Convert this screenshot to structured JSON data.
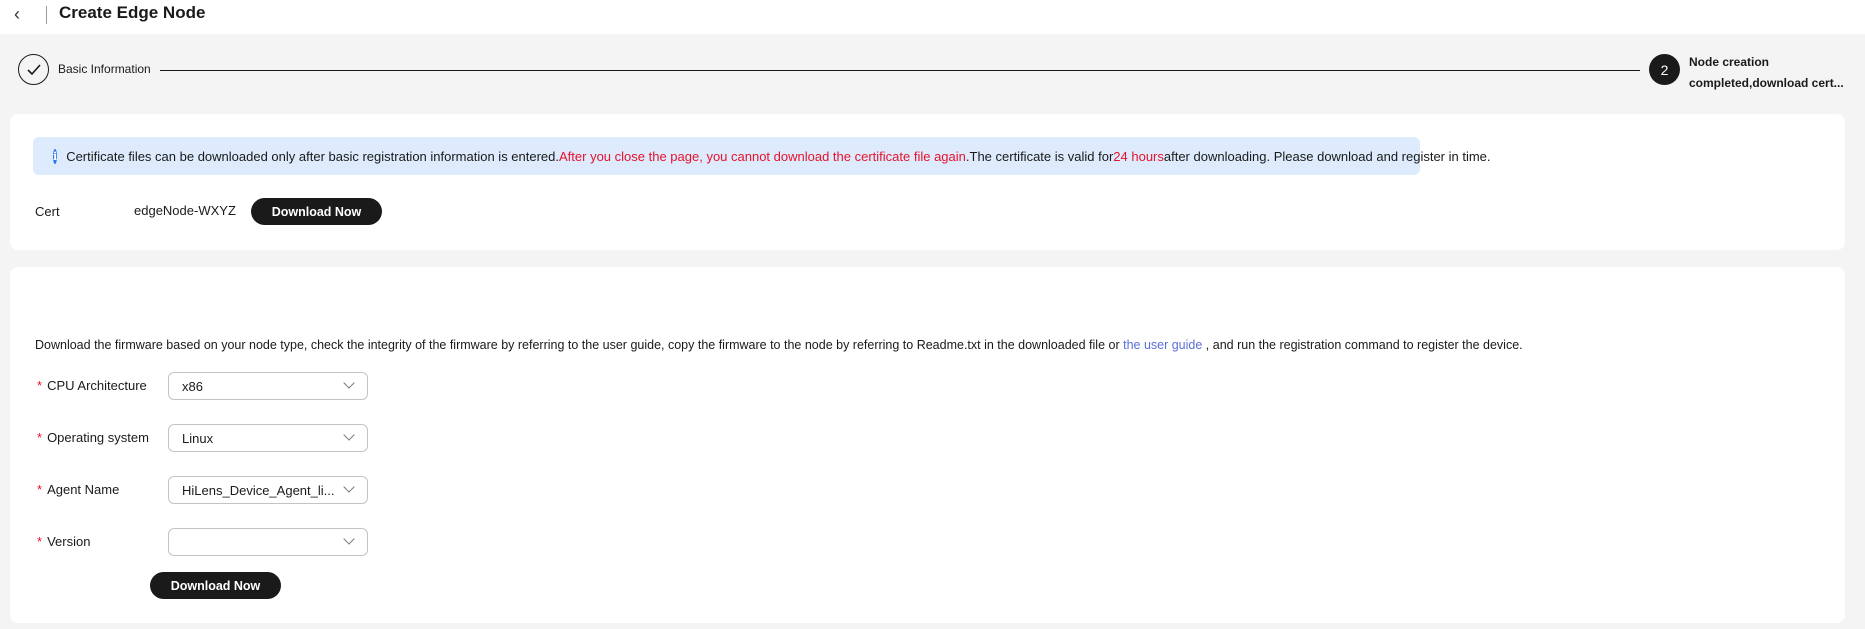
{
  "header": {
    "title": "Create Edge Node",
    "back_icon": "chevron-left-icon"
  },
  "steps": [
    {
      "number": "1",
      "label": "Basic Information",
      "status": "done"
    },
    {
      "number": "2",
      "label_line1": "Node creation",
      "label_line2": "completed,download cert..."
    }
  ],
  "notice": {
    "text1": "Certificate files can be downloaded only after basic registration information is entered. ",
    "warning": "After you close the page, you cannot download the certificate file again",
    "text2": " .The certificate is valid for ",
    "hours": "24 hours",
    "text3": " after downloading. Please download and register in time."
  },
  "cert": {
    "label": "Cert",
    "value": "edgeNode-WXYZ",
    "button": "Download Now"
  },
  "firmware": {
    "desc1": "Download the firmware based on your node type, check the integrity of the firmware by referring to the user guide, copy the firmware to the node by referring to Readme.txt in the downloaded file or ",
    "link": "the user guide",
    "desc2": " , and run the registration command to register the device.",
    "fields": [
      {
        "label": "CPU Architecture",
        "value": "x86"
      },
      {
        "label": "Operating system",
        "value": "Linux"
      },
      {
        "label": "Agent Name",
        "value": "HiLens_Device_Agent_li..."
      },
      {
        "label": "Version",
        "value": ""
      }
    ],
    "button": "Download Now",
    "required_mark": "*"
  },
  "colors": {
    "accent": "#1a1a1a",
    "warning": "#e8122c",
    "info_bg": "#ddebfd",
    "link": "#5b6fd8"
  }
}
